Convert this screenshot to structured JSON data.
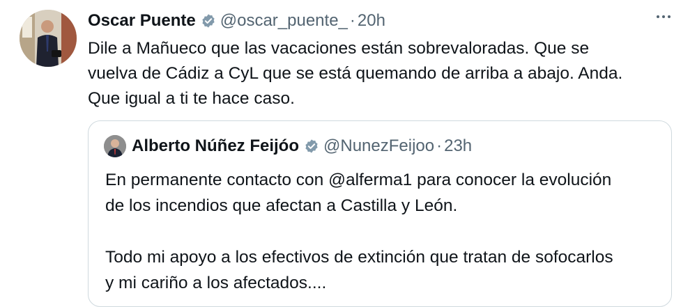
{
  "tweet": {
    "author_name": "Oscar Puente",
    "handle": "@oscar_puente_",
    "separator": "·",
    "time": "20h",
    "text": "Dile a Mañueco que las vacaciones están sobrevaloradas. Que se\nvuelva de Cádiz a CyL que se está quemando de arriba a abajo. Anda.\nQue igual a ti te hace caso."
  },
  "quoted_tweet": {
    "author_name": "Alberto Núñez Feijóo",
    "handle": "@NunezFeijoo",
    "separator": "·",
    "time": "23h",
    "text": "En permanente contacto con @alferma1 para conocer la evolución\nde los incendios que afectan a Castilla y León.\n\nTodo mi apoyo a los efectivos de extinción que tratan de sofocarlos\ny mi cariño a los afectados...."
  },
  "icons": {
    "verified": "verified-badge-icon",
    "more": "more-options-icon"
  },
  "colors": {
    "verified_badge": "#829aab",
    "secondary_text": "#536471",
    "border": "#cfd9de"
  }
}
